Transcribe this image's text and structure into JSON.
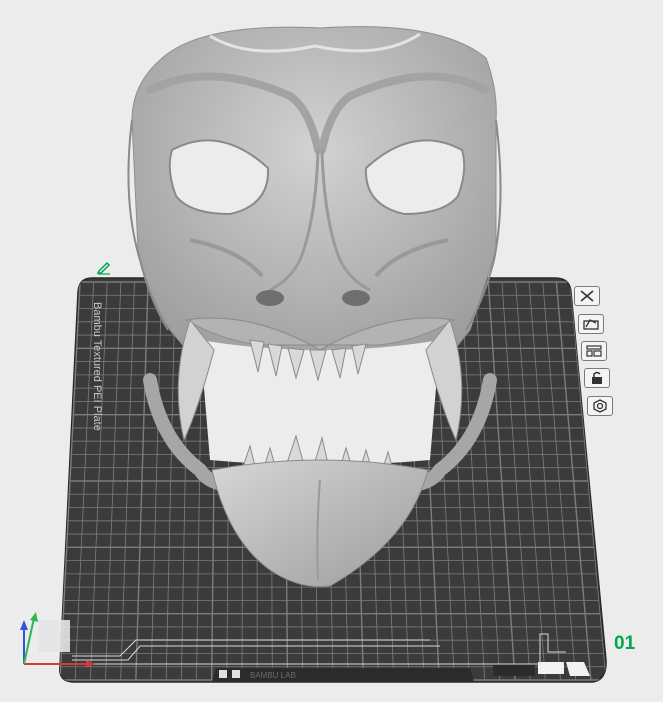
{
  "plate": {
    "type_label": "Bambu Textured PEI Plate",
    "number": "01",
    "footer_text": "BAMBU LAB"
  },
  "toolbar": {
    "buttons": [
      {
        "name": "remove-plate",
        "icon": "close-icon"
      },
      {
        "name": "auto-orient",
        "icon": "orient-icon"
      },
      {
        "name": "arrange",
        "icon": "arrange-icon"
      },
      {
        "name": "lock-plate",
        "icon": "lock-icon"
      },
      {
        "name": "plate-settings",
        "icon": "gear-icon"
      }
    ]
  },
  "colors": {
    "background": "#ececec",
    "plate": "#3b3b3b",
    "grid": "#8a8a8a",
    "model": "#b8b8b8",
    "accent": "#00a84f"
  }
}
